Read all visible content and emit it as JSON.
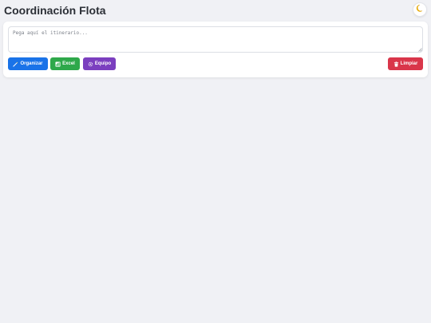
{
  "header": {
    "title": "Coordinación Flota",
    "theme_icon": "moon-icon"
  },
  "editor": {
    "placeholder": "Pega aquí el itinerario..."
  },
  "actions": {
    "organize_label": "Organizar",
    "organize_icon": "magic-wand-icon",
    "excel_label": "Excel",
    "excel_icon": "spreadsheet-icon",
    "team_label": "Equipo",
    "team_icon": "gear-icon",
    "clear_label": "Limpiar",
    "clear_icon": "trash-icon"
  },
  "colors": {
    "background": "#f0f1f5",
    "organize": "#1a73e8",
    "excel": "#2ea84a",
    "team": "#7b3fbf",
    "clear": "#d9364a"
  }
}
